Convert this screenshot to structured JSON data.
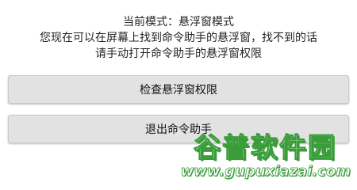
{
  "message": {
    "mode_line": "当前模式：悬浮窗模式",
    "line2": "您现在可以在屏幕上找到命令助手的悬浮窗，找不到的话",
    "line3": "请手动打开命令助手的悬浮窗权限"
  },
  "buttons": {
    "check_label": "检查悬浮窗权限",
    "exit_label": "退出命令助手"
  },
  "watermark": {
    "cn": "谷普软件园",
    "url": "www.gupuxiazai.com"
  },
  "colors": {
    "button_bg": "#e2e2e2",
    "watermark_green": "#3a9d3a"
  }
}
